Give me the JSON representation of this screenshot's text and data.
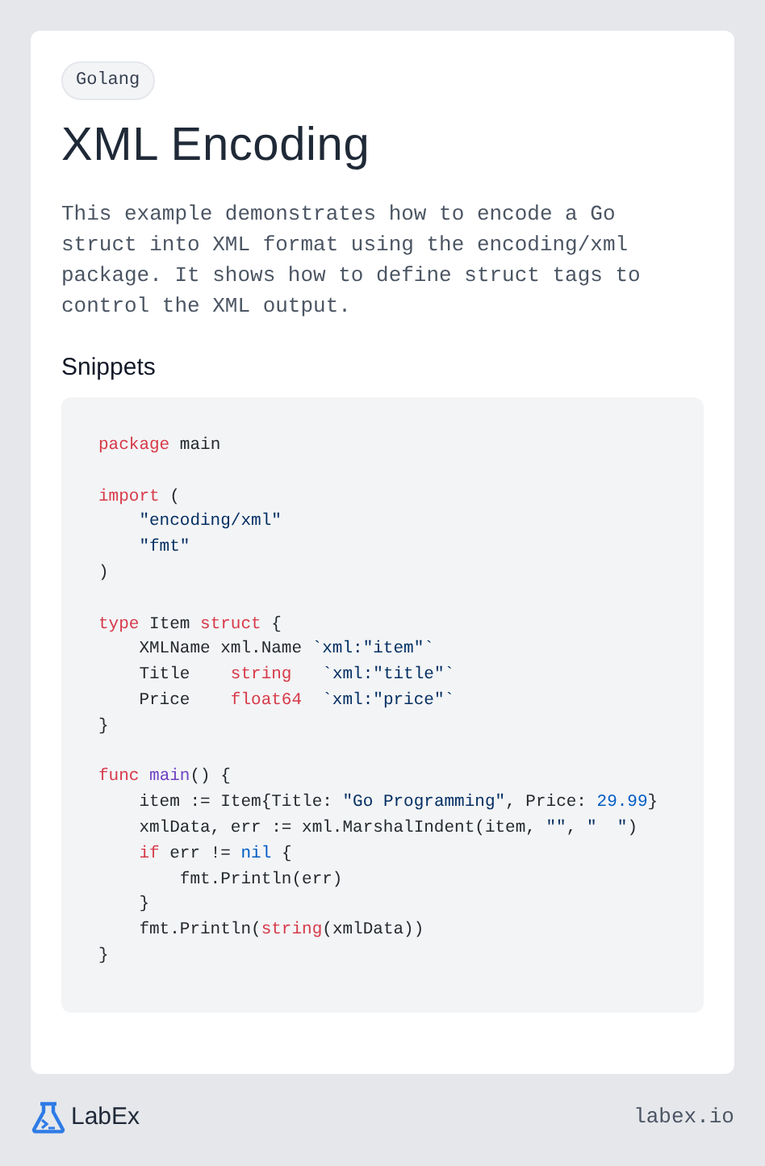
{
  "tag": "Golang",
  "title": "XML Encoding",
  "description": "This example demonstrates how to encode a Go struct into XML format using the encoding/xml package. It shows how to define struct tags to control the XML output.",
  "snippets_heading": "Snippets",
  "code": {
    "lines": [
      {
        "kind": "code",
        "tokens": [
          {
            "kind": "keyword",
            "text": "package"
          },
          {
            "kind": "plain",
            "text": " main"
          }
        ]
      },
      {
        "kind": "blank"
      },
      {
        "kind": "code",
        "tokens": [
          {
            "kind": "keyword",
            "text": "import"
          },
          {
            "kind": "plain",
            "text": " ("
          }
        ]
      },
      {
        "kind": "code",
        "tokens": [
          {
            "kind": "string",
            "text": "    \"encoding/xml\""
          }
        ]
      },
      {
        "kind": "code",
        "tokens": [
          {
            "kind": "string",
            "text": "    \"fmt\""
          }
        ]
      },
      {
        "kind": "code",
        "tokens": [
          {
            "kind": "plain",
            "text": ")"
          }
        ]
      },
      {
        "kind": "blank"
      },
      {
        "kind": "code",
        "tokens": [
          {
            "kind": "keyword",
            "text": "type"
          },
          {
            "kind": "plain",
            "text": " Item "
          },
          {
            "kind": "keyword",
            "text": "struct"
          },
          {
            "kind": "plain",
            "text": " {"
          }
        ]
      },
      {
        "kind": "code",
        "tokens": [
          {
            "kind": "plain",
            "text": "    XMLName xml.Name "
          },
          {
            "kind": "string",
            "text": "`xml:\"item\"`"
          }
        ]
      },
      {
        "kind": "code",
        "tokens": [
          {
            "kind": "plain",
            "text": "    Title    "
          },
          {
            "kind": "keyword",
            "text": "string"
          },
          {
            "kind": "string",
            "text": "   `xml:\"title\"`"
          }
        ]
      },
      {
        "kind": "code",
        "tokens": [
          {
            "kind": "plain",
            "text": "    Price    "
          },
          {
            "kind": "keyword",
            "text": "float64"
          },
          {
            "kind": "string",
            "text": "  `xml:\"price\"`"
          }
        ]
      },
      {
        "kind": "code",
        "tokens": [
          {
            "kind": "plain",
            "text": "}"
          }
        ]
      },
      {
        "kind": "blank"
      },
      {
        "kind": "code",
        "tokens": [
          {
            "kind": "keyword",
            "text": "func"
          },
          {
            "kind": "function",
            "text": " main"
          },
          {
            "kind": "plain",
            "text": "() {"
          }
        ]
      },
      {
        "kind": "code",
        "tokens": [
          {
            "kind": "plain",
            "text": "    item := Item{Title: "
          },
          {
            "kind": "string",
            "text": "\"Go Programming\""
          },
          {
            "kind": "plain",
            "text": ", Price: "
          },
          {
            "kind": "number",
            "text": "29.99"
          },
          {
            "kind": "plain",
            "text": "}"
          }
        ]
      },
      {
        "kind": "code",
        "tokens": [
          {
            "kind": "plain",
            "text": "    xmlData, err := xml.MarshalIndent(item, "
          },
          {
            "kind": "string",
            "text": "\"\""
          },
          {
            "kind": "plain",
            "text": ", "
          },
          {
            "kind": "string",
            "text": "\"  \""
          },
          {
            "kind": "plain",
            "text": ")"
          }
        ]
      },
      {
        "kind": "code",
        "tokens": [
          {
            "kind": "keyword",
            "text": "    if"
          },
          {
            "kind": "plain",
            "text": " err != "
          },
          {
            "kind": "number",
            "text": "nil"
          },
          {
            "kind": "plain",
            "text": " {"
          }
        ]
      },
      {
        "kind": "code",
        "tokens": [
          {
            "kind": "plain",
            "text": "        fmt.Println(err)"
          }
        ]
      },
      {
        "kind": "code",
        "tokens": [
          {
            "kind": "plain",
            "text": "    }"
          }
        ]
      },
      {
        "kind": "code",
        "tokens": [
          {
            "kind": "plain",
            "text": "    fmt.Println("
          },
          {
            "kind": "keyword",
            "text": "string"
          },
          {
            "kind": "plain",
            "text": "(xmlData))"
          }
        ]
      },
      {
        "kind": "code",
        "tokens": [
          {
            "kind": "plain",
            "text": "}"
          }
        ]
      }
    ]
  },
  "footer": {
    "brand": "LabEx",
    "site": "labex.io"
  }
}
